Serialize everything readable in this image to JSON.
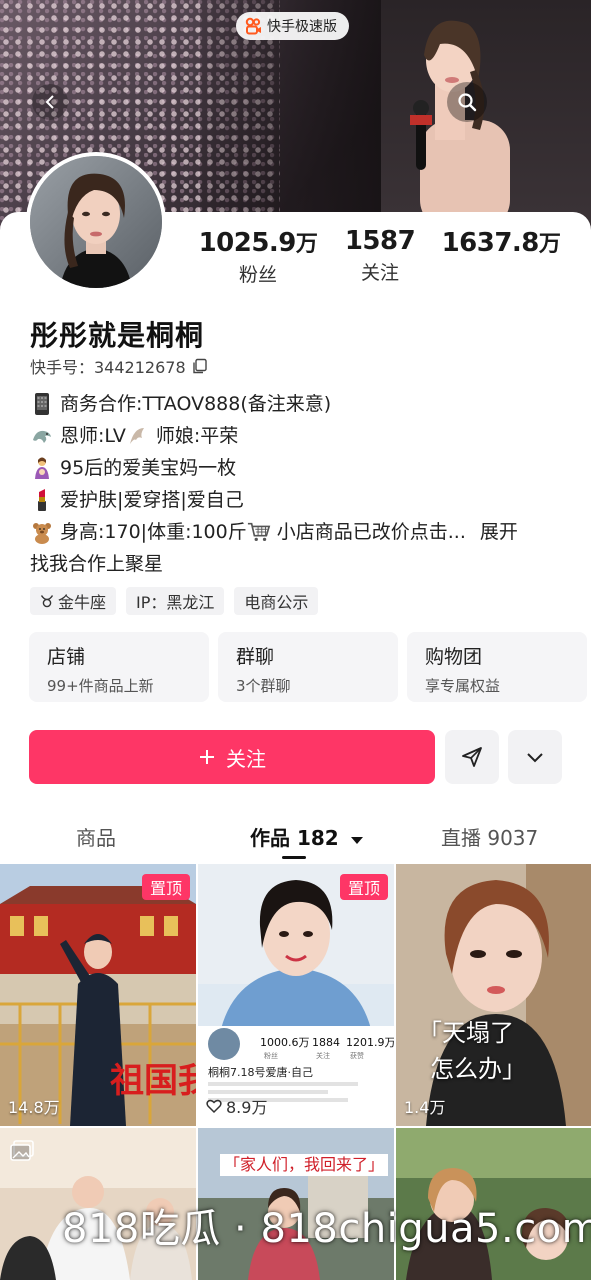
{
  "header": {
    "app_badge": "快手极速版",
    "icons": [
      "back-icon",
      "search-icon"
    ]
  },
  "profile": {
    "nickname": "彤彤就是桐桐",
    "uid_label": "快手号：344212678",
    "stats": [
      {
        "value": "1025.9",
        "unit": "万",
        "label": "粉丝"
      },
      {
        "value": "1587",
        "unit": "",
        "label": "关注"
      },
      {
        "value": "1637.8",
        "unit": "万",
        "label": ""
      }
    ],
    "bio": [
      {
        "icon": "phone-icon",
        "text": "商务合作:TTAOV888(备注来意)"
      },
      {
        "icon": "dragon-icon",
        "text": "恩师:LV",
        "icon2": "dragon-icon",
        "text2": "师娘:平荣"
      },
      {
        "icon": "mother-icon",
        "text": "95后的爱美宝妈一枚"
      },
      {
        "icon": "lipstick-icon",
        "text": "爱护肤|爱穿搭|爱自己"
      },
      {
        "icon": "bear-icon",
        "text": "身高:170|体重:100斤",
        "icon2": "cart-icon",
        "text2": "小店商品已改价点击...",
        "expand": "展开"
      },
      {
        "icon": "",
        "text": "找我合作上聚星"
      }
    ],
    "tags": [
      {
        "icon": "taurus-icon",
        "text": "金牛座"
      },
      {
        "icon": "",
        "text": "IP：黑龙江"
      },
      {
        "icon": "",
        "text": "电商公示"
      }
    ]
  },
  "feature_cards": [
    {
      "title": "店铺",
      "subtitle": "99+件商品上新"
    },
    {
      "title": "群聊",
      "subtitle": "3个群聊"
    },
    {
      "title": "购物团",
      "subtitle": "享专属权益"
    }
  ],
  "actions": {
    "follow_label": "关注",
    "icons": [
      "plus-icon",
      "send-icon",
      "chevron-down-icon"
    ]
  },
  "tabs": [
    {
      "label": "商品",
      "active": false
    },
    {
      "label": "作品 182",
      "active": true
    },
    {
      "label": "直播 9037",
      "active": false
    }
  ],
  "grid": [
    {
      "pin": "置顶",
      "plays": "14.8万",
      "overlay": "祖国我爱",
      "plays_icon": "play-icon"
    },
    {
      "pin": "置顶",
      "plays": "8.9万",
      "plays_icon": "heart-icon",
      "inner_stats": [
        {
          "v": "1000.6万",
          "l": "粉丝"
        },
        {
          "v": "1884",
          "l": "关注"
        },
        {
          "v": "1201.9万",
          "l": "获赞"
        }
      ],
      "inner_title": "桐桐7.18号爱唐·自己"
    },
    {
      "pin": "",
      "plays": "1.4万",
      "plays_icon": "play-icon",
      "caption1": "「天塌了",
      "caption2": "怎么办」"
    },
    {
      "pin": "",
      "plays": "",
      "icon": "gallery-icon"
    },
    {
      "pin": "",
      "plays": "",
      "caption1": "「家人们，我回来了」"
    },
    {
      "pin": "",
      "plays": ""
    }
  ],
  "watermark": "818吃瓜 · 818chigua5.com",
  "colors": {
    "accent": "#fe3666",
    "chip_bg": "#f2f2f4",
    "card_bg": "#f5f5f7"
  }
}
